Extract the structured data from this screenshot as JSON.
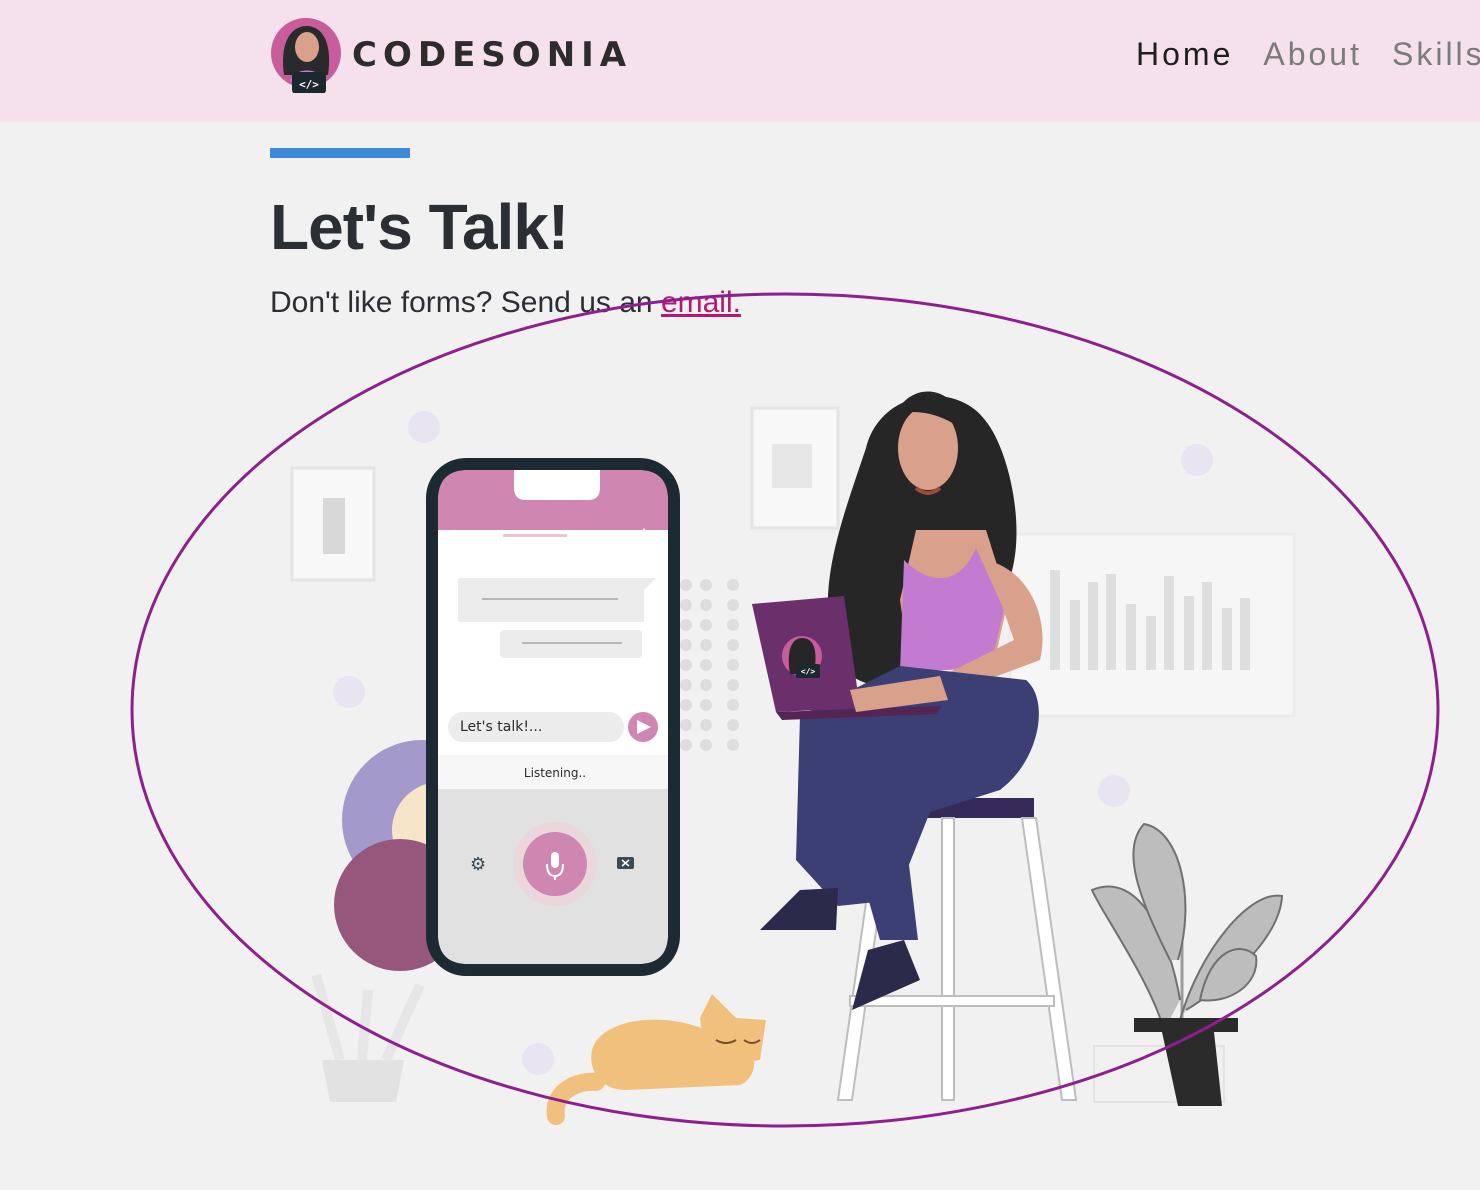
{
  "brand": {
    "name": "CODESONIA",
    "logo_code_glyph": "</>"
  },
  "nav": {
    "items": [
      {
        "label": "Home",
        "active": true
      },
      {
        "label": "About",
        "active": false
      },
      {
        "label": "Skills",
        "active": false
      }
    ]
  },
  "main": {
    "title": "Let's Talk!",
    "subtitle_prefix": "Don't like forms? Send us an ",
    "email_link": "email."
  },
  "illustration": {
    "phone_message": "Let's talk!...",
    "phone_status": "Listening..",
    "laptop_glyph": "</>"
  },
  "colors": {
    "nav_bg": "#f4e1ec",
    "accent_bar": "#3f8ad8",
    "link": "#b5196f",
    "annotation_ellipse": "#8e1f8e",
    "phone_header": "#cf86b0"
  }
}
